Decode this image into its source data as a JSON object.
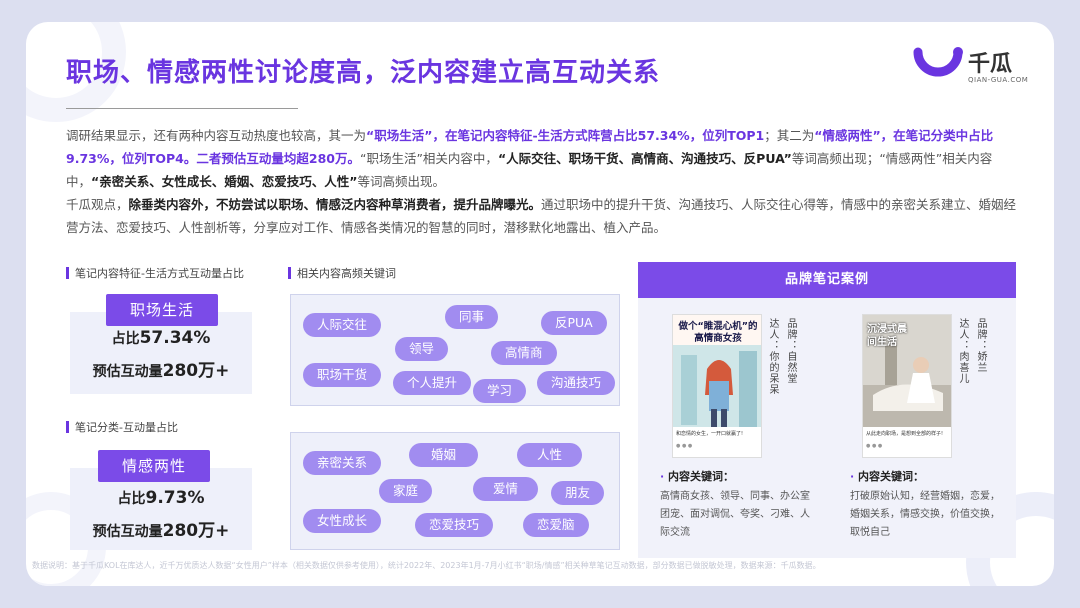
{
  "title": "职场、情感两性讨论度高，泛内容建立高互动关系",
  "logo": {
    "name": "千瓜",
    "sub": "QIAN-GUA.COM"
  },
  "colors": {
    "accent": "#6a35e0",
    "pill": "#7b4be8",
    "keyword": "#a18cf0",
    "panel": "#eef0fa"
  },
  "paragraph": {
    "p1_a": "调研结果显示，还有两种内容互动热度也较高，其一为",
    "p1_b": "“职场生活”，在笔记内容特征-生活方式阵营占比57.34%，位列TOP1",
    "p1_c": "；其二为",
    "p1_d": "“情感两性”，在笔记分类中占比9.73%，位列TOP4。二者预估互动量均超280万。",
    "p1_e": "“职场生活”相关内容中，",
    "p1_f": "“人际交往、职场干货、高情商、沟通技巧、反PUA”",
    "p1_g": "等词高频出现；“情感两性”相关内容中，",
    "p1_h": "“亲密关系、女性成长、婚姻、恋爱技巧、人性”",
    "p1_i": "等词高频出现。",
    "p2_a": "千瓜观点，",
    "p2_b": "除垂类内容外，不妨尝试以职场、情感泛内容种草消费者，提升品牌曝光。",
    "p2_c": "通过职场中的提升干货、沟通技巧、人际交往心得等，情感中的亲密关系建立、婚姻经营方法、恋爱技巧、人性剖析等，分享应对工作、情感各类情况的智慧的同时，潜移默化地露出、植入产品。"
  },
  "stats": {
    "section1_label": "笔记内容特征-生活方式互动量占比",
    "section2_label": "笔记分类-互动量占比",
    "keywords_label": "相关内容高频关键词",
    "block1": {
      "pill": "职场生活",
      "share_prefix": "占比",
      "share_value": "57.34%",
      "inter_prefix": "预估互动量",
      "inter_value": "280万+"
    },
    "block2": {
      "pill": "情感两性",
      "share_prefix": "占比",
      "share_value": "9.73%",
      "inter_prefix": "预估互动量",
      "inter_value": "280万+"
    }
  },
  "keywords1": [
    "人际交往",
    "同事",
    "反PUA",
    "领导",
    "高情商",
    "职场干货",
    "个人提升",
    "学习",
    "沟通技巧"
  ],
  "keywords2": [
    "亲密关系",
    "婚姻",
    "人性",
    "家庭",
    "爱情",
    "朋友",
    "女性成长",
    "恋爱技巧",
    "恋爱脑"
  ],
  "cases": {
    "header": "品牌笔记案例",
    "card1": {
      "overlay": "做个“睢混心机”的高情商女孩",
      "caption": "和恋情的女生，一开口就赢了!",
      "vertical1": "品牌：自然堂",
      "vertical2": "达人：你的呆呆",
      "kw_title": "内容关键词：",
      "kw_text": "高情商女孩、领导、同事、办公室团宠、面对调侃、夸奖、刁难、人际交流"
    },
    "card2": {
      "overlay": "沉浸式晨间生活",
      "caption": "从此走向职场，是想到全部的样子!",
      "vertical1": "品牌：娇兰",
      "vertical2": "达人：肉喜儿",
      "kw_title": "内容关键词：",
      "kw_text": "打破原始认知，经营婚姻，恋爱，婚姻关系，情感交换，价值交换，取悦自己"
    }
  },
  "footnote": "数据说明：基于千瓜KOL在库达人，近千万优质达人数据“女性用户”样本（相关数据仅供参考使用），统计2022年、2023年1月-7月小红书“职场/情感”相关种草笔记互动数据，部分数据已做脱敏处理，数据来源：千瓜数据。"
}
